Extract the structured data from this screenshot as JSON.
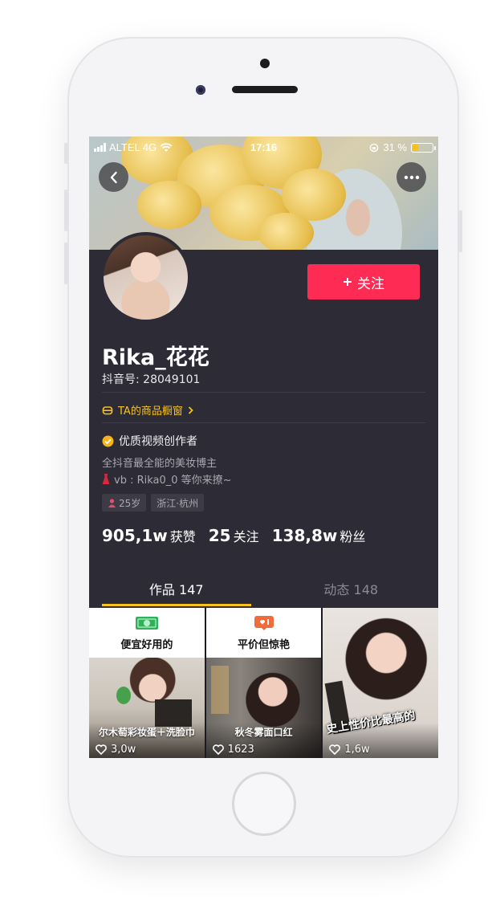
{
  "status_bar": {
    "carrier": "ALTEL 4G",
    "time": "17:16",
    "battery_percent": "31 %",
    "battery_level": 0.31
  },
  "profile": {
    "follow_label": "关注",
    "name": "Rika_花花",
    "douyin_id": "抖音号: 28049101",
    "shop_link": "TA的商品橱窗",
    "verified_label": "优质视频创作者",
    "bio_line1": "全抖音最全能的美妆博主",
    "bio_line2": "vb : Rika0_0  等你来撩~",
    "tags": [
      "25岁",
      "浙江·杭州"
    ],
    "stats": [
      {
        "num": "905,1w",
        "label": "获赞"
      },
      {
        "num": "25",
        "label": "关注"
      },
      {
        "num": "138,8w",
        "label": "粉丝"
      }
    ]
  },
  "tabs": {
    "works": "作品 147",
    "activity": "动态 148"
  },
  "videos": [
    {
      "header_title": "便宜好用的",
      "caption": "尔木萄彩妆蛋＋洗脸巾",
      "likes": "3,0w"
    },
    {
      "header_title": "平价但惊艳",
      "caption": "秋冬雾面口红",
      "likes": "1623"
    },
    {
      "overlay_text": "史上性价比最高的",
      "likes": "1,6w"
    }
  ],
  "colors": {
    "accent_red": "#fe2c55",
    "accent_yellow": "#f7c21e",
    "background": "#2d2b36"
  }
}
